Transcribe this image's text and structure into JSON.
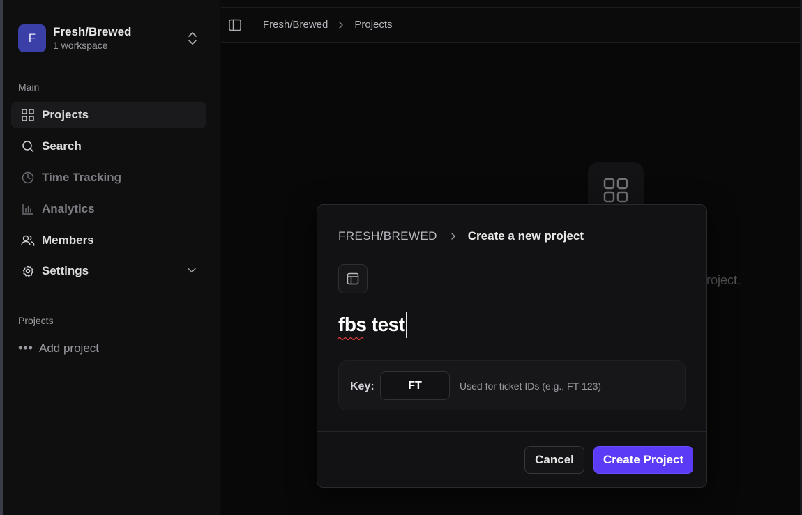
{
  "workspace": {
    "avatar_letter": "F",
    "name": "Fresh/Brewed",
    "subtitle": "1 workspace"
  },
  "sidebar": {
    "main_label": "Main",
    "items": [
      {
        "label": "Projects",
        "icon": "grid-icon",
        "active": true
      },
      {
        "label": "Search",
        "icon": "search-icon"
      },
      {
        "label": "Time Tracking",
        "icon": "clock-icon",
        "dim": true
      },
      {
        "label": "Analytics",
        "icon": "bar-chart-icon",
        "dim": true
      },
      {
        "label": "Members",
        "icon": "users-icon"
      },
      {
        "label": "Settings",
        "icon": "gear-icon",
        "has_chevron": true
      }
    ],
    "projects_label": "Projects",
    "add_project_label": "Add project"
  },
  "topbar": {
    "breadcrumb": [
      "Fresh/Brewed",
      "Projects"
    ]
  },
  "main": {
    "empty_text_visible": "roject."
  },
  "modal": {
    "org": "FRESH/BREWED",
    "title": "Create a new project",
    "project_name": "fbs test",
    "key_label": "Key:",
    "key_value": "FT",
    "key_help": "Used for ticket IDs (e.g., FT-123)",
    "cancel_label": "Cancel",
    "create_label": "Create Project"
  },
  "colors": {
    "accent": "#5b3bf5",
    "avatar": "#3b3fa8",
    "background": "#0b0b0c"
  }
}
